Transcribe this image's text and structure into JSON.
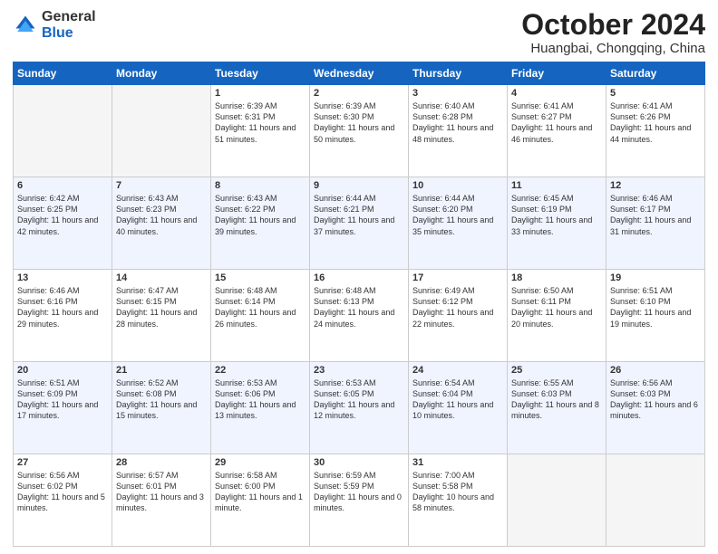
{
  "logo": {
    "general": "General",
    "blue": "Blue"
  },
  "header": {
    "month": "October 2024",
    "location": "Huangbai, Chongqing, China"
  },
  "days_of_week": [
    "Sunday",
    "Monday",
    "Tuesday",
    "Wednesday",
    "Thursday",
    "Friday",
    "Saturday"
  ],
  "weeks": [
    [
      {
        "day": "",
        "info": ""
      },
      {
        "day": "",
        "info": ""
      },
      {
        "day": "1",
        "info": "Sunrise: 6:39 AM\nSunset: 6:31 PM\nDaylight: 11 hours and 51 minutes."
      },
      {
        "day": "2",
        "info": "Sunrise: 6:39 AM\nSunset: 6:30 PM\nDaylight: 11 hours and 50 minutes."
      },
      {
        "day": "3",
        "info": "Sunrise: 6:40 AM\nSunset: 6:28 PM\nDaylight: 11 hours and 48 minutes."
      },
      {
        "day": "4",
        "info": "Sunrise: 6:41 AM\nSunset: 6:27 PM\nDaylight: 11 hours and 46 minutes."
      },
      {
        "day": "5",
        "info": "Sunrise: 6:41 AM\nSunset: 6:26 PM\nDaylight: 11 hours and 44 minutes."
      }
    ],
    [
      {
        "day": "6",
        "info": "Sunrise: 6:42 AM\nSunset: 6:25 PM\nDaylight: 11 hours and 42 minutes."
      },
      {
        "day": "7",
        "info": "Sunrise: 6:43 AM\nSunset: 6:23 PM\nDaylight: 11 hours and 40 minutes."
      },
      {
        "day": "8",
        "info": "Sunrise: 6:43 AM\nSunset: 6:22 PM\nDaylight: 11 hours and 39 minutes."
      },
      {
        "day": "9",
        "info": "Sunrise: 6:44 AM\nSunset: 6:21 PM\nDaylight: 11 hours and 37 minutes."
      },
      {
        "day": "10",
        "info": "Sunrise: 6:44 AM\nSunset: 6:20 PM\nDaylight: 11 hours and 35 minutes."
      },
      {
        "day": "11",
        "info": "Sunrise: 6:45 AM\nSunset: 6:19 PM\nDaylight: 11 hours and 33 minutes."
      },
      {
        "day": "12",
        "info": "Sunrise: 6:46 AM\nSunset: 6:17 PM\nDaylight: 11 hours and 31 minutes."
      }
    ],
    [
      {
        "day": "13",
        "info": "Sunrise: 6:46 AM\nSunset: 6:16 PM\nDaylight: 11 hours and 29 minutes."
      },
      {
        "day": "14",
        "info": "Sunrise: 6:47 AM\nSunset: 6:15 PM\nDaylight: 11 hours and 28 minutes."
      },
      {
        "day": "15",
        "info": "Sunrise: 6:48 AM\nSunset: 6:14 PM\nDaylight: 11 hours and 26 minutes."
      },
      {
        "day": "16",
        "info": "Sunrise: 6:48 AM\nSunset: 6:13 PM\nDaylight: 11 hours and 24 minutes."
      },
      {
        "day": "17",
        "info": "Sunrise: 6:49 AM\nSunset: 6:12 PM\nDaylight: 11 hours and 22 minutes."
      },
      {
        "day": "18",
        "info": "Sunrise: 6:50 AM\nSunset: 6:11 PM\nDaylight: 11 hours and 20 minutes."
      },
      {
        "day": "19",
        "info": "Sunrise: 6:51 AM\nSunset: 6:10 PM\nDaylight: 11 hours and 19 minutes."
      }
    ],
    [
      {
        "day": "20",
        "info": "Sunrise: 6:51 AM\nSunset: 6:09 PM\nDaylight: 11 hours and 17 minutes."
      },
      {
        "day": "21",
        "info": "Sunrise: 6:52 AM\nSunset: 6:08 PM\nDaylight: 11 hours and 15 minutes."
      },
      {
        "day": "22",
        "info": "Sunrise: 6:53 AM\nSunset: 6:06 PM\nDaylight: 11 hours and 13 minutes."
      },
      {
        "day": "23",
        "info": "Sunrise: 6:53 AM\nSunset: 6:05 PM\nDaylight: 11 hours and 12 minutes."
      },
      {
        "day": "24",
        "info": "Sunrise: 6:54 AM\nSunset: 6:04 PM\nDaylight: 11 hours and 10 minutes."
      },
      {
        "day": "25",
        "info": "Sunrise: 6:55 AM\nSunset: 6:03 PM\nDaylight: 11 hours and 8 minutes."
      },
      {
        "day": "26",
        "info": "Sunrise: 6:56 AM\nSunset: 6:03 PM\nDaylight: 11 hours and 6 minutes."
      }
    ],
    [
      {
        "day": "27",
        "info": "Sunrise: 6:56 AM\nSunset: 6:02 PM\nDaylight: 11 hours and 5 minutes."
      },
      {
        "day": "28",
        "info": "Sunrise: 6:57 AM\nSunset: 6:01 PM\nDaylight: 11 hours and 3 minutes."
      },
      {
        "day": "29",
        "info": "Sunrise: 6:58 AM\nSunset: 6:00 PM\nDaylight: 11 hours and 1 minute."
      },
      {
        "day": "30",
        "info": "Sunrise: 6:59 AM\nSunset: 5:59 PM\nDaylight: 11 hours and 0 minutes."
      },
      {
        "day": "31",
        "info": "Sunrise: 7:00 AM\nSunset: 5:58 PM\nDaylight: 10 hours and 58 minutes."
      },
      {
        "day": "",
        "info": ""
      },
      {
        "day": "",
        "info": ""
      }
    ]
  ]
}
